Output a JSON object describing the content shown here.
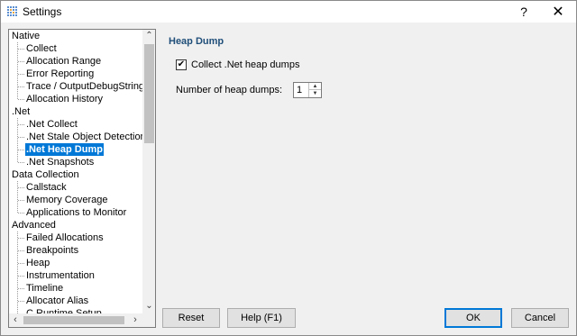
{
  "window": {
    "title": "Settings",
    "help_glyph": "?",
    "close_glyph": "✕"
  },
  "tree": {
    "items": [
      {
        "label": "Native",
        "level": 0
      },
      {
        "label": "Collect",
        "level": 1
      },
      {
        "label": "Allocation Range",
        "level": 1
      },
      {
        "label": "Error Reporting",
        "level": 1
      },
      {
        "label": "Trace / OutputDebugString",
        "level": 1
      },
      {
        "label": "Allocation History",
        "level": 1
      },
      {
        "label": ".Net",
        "level": 0
      },
      {
        "label": ".Net Collect",
        "level": 1
      },
      {
        "label": ".Net Stale Object Detection",
        "level": 1
      },
      {
        "label": ".Net Heap Dump",
        "level": 1,
        "selected": true
      },
      {
        "label": ".Net Snapshots",
        "level": 1
      },
      {
        "label": "Data Collection",
        "level": 0
      },
      {
        "label": "Callstack",
        "level": 1
      },
      {
        "label": "Memory Coverage",
        "level": 1
      },
      {
        "label": "Applications to Monitor",
        "level": 1
      },
      {
        "label": "Advanced",
        "level": 0
      },
      {
        "label": "Failed Allocations",
        "level": 1
      },
      {
        "label": "Breakpoints",
        "level": 1
      },
      {
        "label": "Heap",
        "level": 1
      },
      {
        "label": "Instrumentation",
        "level": 1
      },
      {
        "label": "Timeline",
        "level": 1
      },
      {
        "label": "Allocator Alias",
        "level": 1
      },
      {
        "label": "C Runtime Setup",
        "level": 1
      }
    ],
    "scroll": {
      "up": "⌃",
      "down": "⌄",
      "left": "‹",
      "right": "›"
    }
  },
  "panel": {
    "title": "Heap Dump",
    "collect_checkbox": {
      "label": "Collect .Net heap dumps",
      "checked": true,
      "glyph": "✔"
    },
    "heap_dumps": {
      "label": "Number of heap dumps:",
      "value": "1"
    }
  },
  "buttons": {
    "reset": "Reset",
    "help": "Help (F1)",
    "ok": "OK",
    "cancel": "Cancel"
  },
  "colors": {
    "selection": "#0078d7",
    "panel_title": "#1f4e79"
  }
}
